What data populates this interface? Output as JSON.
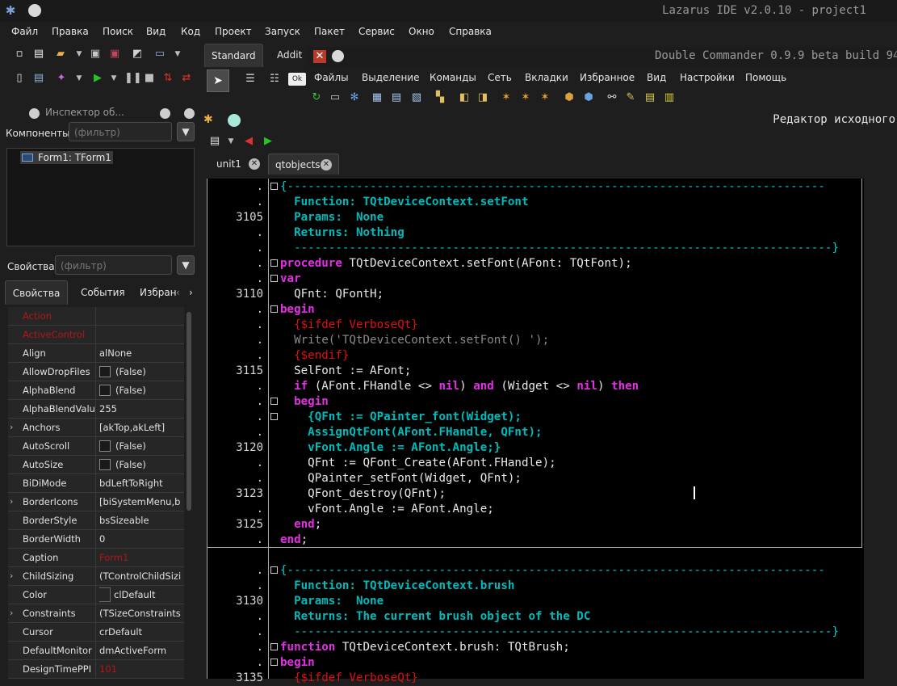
{
  "window": {
    "title": "Lazarus IDE v2.0.10 - project1"
  },
  "main_menu": [
    "Файл",
    "Правка",
    "Поиск",
    "Вид",
    "Код",
    "Проект",
    "Запуск",
    "Пакет",
    "Сервис",
    "Окно",
    "Справка"
  ],
  "palette": {
    "tabs": [
      "Standard",
      "Addit"
    ]
  },
  "dc": {
    "title": "Double Commander 0.9.9 beta build 94",
    "menu": [
      "Файлы",
      "Выделение",
      "Команды",
      "Сеть",
      "Вкладки",
      "Избранное",
      "Вид",
      "Настройки",
      "Помощь"
    ]
  },
  "inspector": {
    "title": "Инспектор об...",
    "components_label": "Компоненты",
    "components_filter": "(фильтр)",
    "tree_node": "Form1: TForm1",
    "props_label": "Свойства",
    "props_filter": "(фильтр)",
    "tabs": [
      "Свойства",
      "События",
      "Избран"
    ],
    "rows": [
      {
        "name": "Action",
        "value": "",
        "name_red": true
      },
      {
        "name": "ActiveControl",
        "value": "",
        "name_red": true
      },
      {
        "name": "Align",
        "value": "alNone"
      },
      {
        "name": "AllowDropFiles",
        "value": "(False)",
        "check": true
      },
      {
        "name": "AlphaBlend",
        "value": "(False)",
        "check": true
      },
      {
        "name": "AlphaBlendValu",
        "value": "255"
      },
      {
        "name": "Anchors",
        "value": "[akTop,akLeft]",
        "expand": true
      },
      {
        "name": "AutoScroll",
        "value": "(False)",
        "check": true
      },
      {
        "name": "AutoSize",
        "value": "(False)",
        "check": true
      },
      {
        "name": "BiDiMode",
        "value": "bdLeftToRight"
      },
      {
        "name": "BorderIcons",
        "value": "[biSystemMenu,b",
        "expand": true
      },
      {
        "name": "BorderStyle",
        "value": "bsSizeable"
      },
      {
        "name": "BorderWidth",
        "value": "0"
      },
      {
        "name": "Caption",
        "value": "Form1",
        "value_red": true
      },
      {
        "name": "ChildSizing",
        "value": "(TControlChildSizi",
        "expand": true
      },
      {
        "name": "Color",
        "value": "clDefault",
        "swatch": true
      },
      {
        "name": "Constraints",
        "value": "(TSizeConstraints",
        "expand": true
      },
      {
        "name": "Cursor",
        "value": "crDefault"
      },
      {
        "name": "DefaultMonitor",
        "value": "dmActiveForm"
      },
      {
        "name": "DesignTimePPI",
        "value": "101",
        "value_red": true
      }
    ]
  },
  "editor": {
    "title": "Редактор исходного",
    "tabs": [
      "unit1",
      "qtobjects"
    ],
    "lines": [
      {
        "num": ".",
        "fold": true,
        "parts": [
          {
            "c": "cm",
            "t": "{------------------------------------------------------------------------------"
          }
        ]
      },
      {
        "num": ".",
        "parts": [
          {
            "c": "cmb",
            "t": "  Function: TQtDeviceContext.setFont"
          }
        ]
      },
      {
        "num": "3105",
        "parts": [
          {
            "c": "cmb",
            "t": "  Params:  None"
          }
        ]
      },
      {
        "num": ".",
        "parts": [
          {
            "c": "cmb",
            "t": "  Returns: Nothing"
          }
        ]
      },
      {
        "num": ".",
        "parts": [
          {
            "c": "cm",
            "t": "  ------------------------------------------------------------------------------}"
          }
        ]
      },
      {
        "num": ".",
        "fold": true,
        "parts": [
          {
            "c": "kw",
            "t": "procedure"
          },
          {
            "c": "",
            "t": " TQtDeviceContext.setFont(AFont: TQtFont);"
          }
        ]
      },
      {
        "num": ".",
        "fold": true,
        "parts": [
          {
            "c": "kw",
            "t": "var"
          }
        ]
      },
      {
        "num": "3110",
        "parts": [
          {
            "c": "",
            "t": "  QFnt: QFontH;"
          }
        ]
      },
      {
        "num": ".",
        "fold": true,
        "parts": [
          {
            "c": "kw",
            "t": "begin"
          }
        ]
      },
      {
        "num": ".",
        "parts": [
          {
            "c": "dr",
            "t": "  {$ifdef VerboseQt}"
          }
        ]
      },
      {
        "num": ".",
        "parts": [
          {
            "c": "str",
            "t": "  Write('TQtDeviceContext.setFont() ');"
          }
        ]
      },
      {
        "num": ".",
        "parts": [
          {
            "c": "dr",
            "t": "  {$endif}"
          }
        ]
      },
      {
        "num": "3115",
        "parts": [
          {
            "c": "",
            "t": "  SelFont := AFont;"
          }
        ]
      },
      {
        "num": ".",
        "parts": [
          {
            "c": "kw",
            "t": "  if"
          },
          {
            "c": "",
            "t": " (AFont.FHandle <> "
          },
          {
            "c": "kw",
            "t": "nil"
          },
          {
            "c": "",
            "t": ") "
          },
          {
            "c": "kw",
            "t": "and"
          },
          {
            "c": "",
            "t": " (Widget <> "
          },
          {
            "c": "kw",
            "t": "nil"
          },
          {
            "c": "",
            "t": ") "
          },
          {
            "c": "kw",
            "t": "then"
          }
        ]
      },
      {
        "num": ".",
        "fold": true,
        "parts": [
          {
            "c": "kw",
            "t": "  begin"
          }
        ]
      },
      {
        "num": ".",
        "fold": true,
        "parts": [
          {
            "c": "cmb",
            "t": "    {QFnt := QPainter_font(Widget);"
          }
        ]
      },
      {
        "num": ".",
        "parts": [
          {
            "c": "cmb",
            "t": "    AssignQtFont(AFont.FHandle, QFnt);"
          }
        ]
      },
      {
        "num": "3120",
        "parts": [
          {
            "c": "cmb",
            "t": "    vFont.Angle := AFont.Angle;}"
          }
        ]
      },
      {
        "num": ".",
        "parts": [
          {
            "c": "",
            "t": "    QFnt := QFont_Create(AFont.FHandle);"
          }
        ]
      },
      {
        "num": ".",
        "parts": [
          {
            "c": "",
            "t": "    QPainter_setFont(Widget, QFnt);"
          }
        ]
      },
      {
        "num": "3123",
        "parts": [
          {
            "c": "",
            "t": "    QFont_destroy(QFnt);"
          }
        ]
      },
      {
        "num": ".",
        "parts": [
          {
            "c": "",
            "t": "    vFont.Angle := AFont.Angle;"
          }
        ]
      },
      {
        "num": "3125",
        "parts": [
          {
            "c": "kw",
            "t": "  end"
          },
          {
            "c": "",
            "t": ";"
          }
        ]
      },
      {
        "num": ".",
        "parts": [
          {
            "c": "kw",
            "t": "end"
          },
          {
            "c": "",
            "t": ";"
          }
        ]
      },
      {
        "num": "",
        "parts": []
      },
      {
        "num": ".",
        "fold": true,
        "parts": [
          {
            "c": "cm",
            "t": "{------------------------------------------------------------------------------"
          }
        ]
      },
      {
        "num": ".",
        "parts": [
          {
            "c": "cmb",
            "t": "  Function: TQtDeviceContext.brush"
          }
        ]
      },
      {
        "num": "3130",
        "parts": [
          {
            "c": "cmb",
            "t": "  Params:  None"
          }
        ]
      },
      {
        "num": ".",
        "parts": [
          {
            "c": "cmb",
            "t": "  Returns: The current brush object of the DC"
          }
        ]
      },
      {
        "num": ".",
        "parts": [
          {
            "c": "cm",
            "t": "  ------------------------------------------------------------------------------}"
          }
        ]
      },
      {
        "num": ".",
        "fold": true,
        "parts": [
          {
            "c": "kw",
            "t": "function"
          },
          {
            "c": "",
            "t": " TQtDeviceContext.brush: TQtBrush;"
          }
        ]
      },
      {
        "num": ".",
        "fold": true,
        "parts": [
          {
            "c": "kw",
            "t": "begin"
          }
        ]
      },
      {
        "num": "3135",
        "parts": [
          {
            "c": "dr",
            "t": "  {$ifdef VerboseQt}"
          }
        ]
      }
    ]
  }
}
